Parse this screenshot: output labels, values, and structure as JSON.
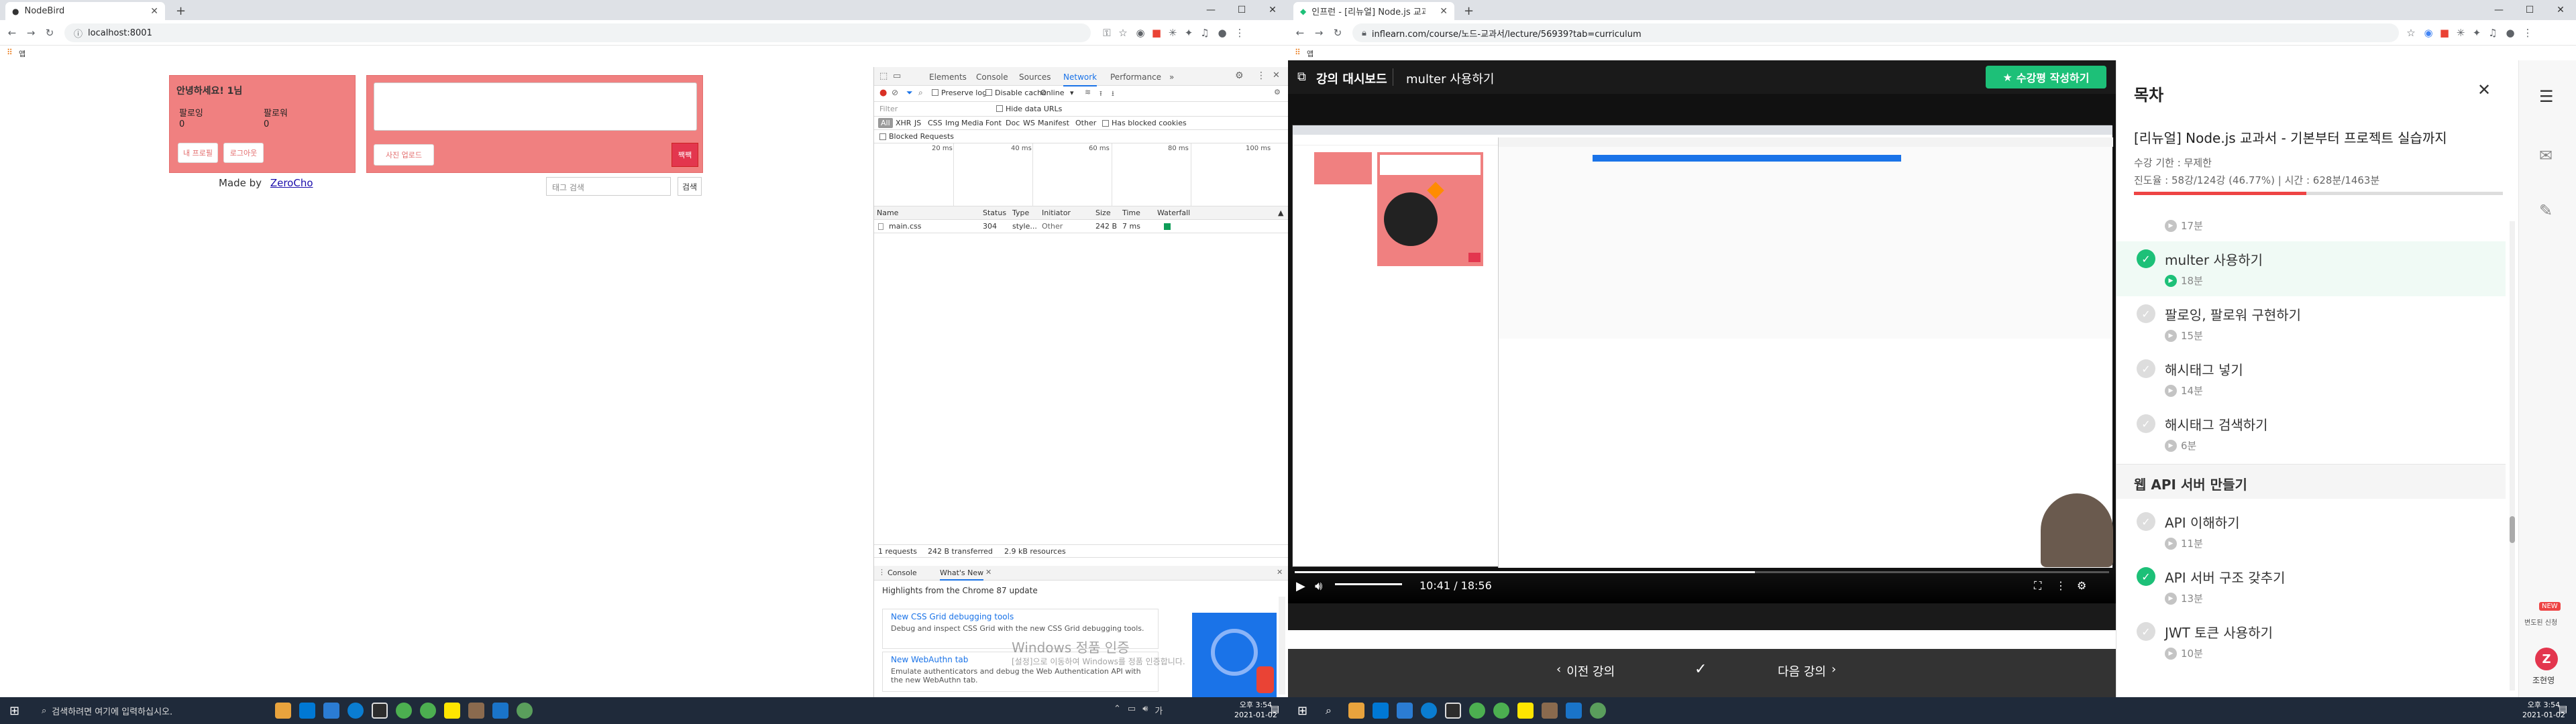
{
  "left": {
    "tabs": [
      {
        "title": "NodeBird"
      }
    ],
    "url": "localhost:8001",
    "bookmark_label": "앱",
    "page": {
      "greeting": "안녕하세요! 1님",
      "following_label": "팔로잉",
      "follower_label": "팔로워",
      "following_count": "0",
      "follower_count": "0",
      "my_profile_btn": "내 프로필",
      "logout_btn": "로그아웃",
      "made_by": "Made by",
      "author_link": "ZeroCho",
      "photo_upload_btn": "사진 업로드",
      "tweet_btn": "짹짹",
      "tag_search_placeholder": "태그 검색",
      "search_btn": "검색"
    },
    "devtools": {
      "tabs": [
        "Elements",
        "Console",
        "Sources",
        "Network",
        "Performance"
      ],
      "active_tab": "Network",
      "preserve_log": "Preserve log",
      "disable_cache": "Disable cache",
      "throttle": "Online",
      "filter_placeholder": "Filter",
      "hide_data_urls": "Hide data URLs",
      "filter_types": [
        "All",
        "XHR",
        "JS",
        "CSS",
        "Img",
        "Media",
        "Font",
        "Doc",
        "WS",
        "Manifest",
        "Other"
      ],
      "has_blocked_cookies": "Has blocked cookies",
      "blocked_requests": "Blocked Requests",
      "timeline_ticks": [
        "20 ms",
        "40 ms",
        "60 ms",
        "80 ms",
        "100 ms"
      ],
      "columns": [
        "Name",
        "Status",
        "Type",
        "Initiator",
        "Size",
        "Time",
        "Waterfall"
      ],
      "rows": [
        {
          "name": "main.css",
          "status": "304",
          "type": "style...",
          "initiator": "Other",
          "size": "242 B",
          "time": "7 ms"
        }
      ],
      "summary": [
        "1 requests",
        "242 B transferred",
        "2.9 kB resources"
      ],
      "drawer_tabs": [
        "Console",
        "What's New"
      ],
      "drawer_heading": "Highlights from the Chrome 87 update",
      "news": [
        {
          "title": "New CSS Grid debugging tools",
          "desc": "Debug and inspect CSS Grid with the new CSS Grid debugging tools."
        },
        {
          "title": "New WebAuthn tab",
          "desc": "Emulate authenticators and debug the Web Authentication API with the new WebAuthn tab."
        }
      ],
      "watermark_title": "Windows 정품 인증",
      "watermark_sub": "[설정]으로 이동하여 Windows를 정품 인증합니다."
    }
  },
  "right": {
    "tabs": [
      {
        "title": "인프런 - [리뉴얼] Node.js 교과서 ..."
      }
    ],
    "url": "inflearn.com/course/노드-교과서/lecture/56939?tab=curriculum",
    "bookmark_label": "앱",
    "dashboard_label": "강의 대시보드",
    "lecture_title": "multer 사용하기",
    "review_btn": "수강평 작성하기",
    "video_time": "10:41 / 18:56",
    "video_progress": 0.565,
    "prev_btn": "이전 강의",
    "next_btn": "다음 강의",
    "sidebar": {
      "title": "목차",
      "course_title": "[리뉴얼] Node.js 교과서 - 기본부터 프로젝트 실습까지",
      "period": "수강 기한 : 무제한",
      "progress_text": "진도율 : 58강/124강 (46.77%) | 시간 : 628분/1463분",
      "progress": 0.4677,
      "lessons": [
        {
          "title": "",
          "duration": "17분",
          "done": false,
          "current": false
        },
        {
          "title": "multer 사용하기",
          "duration": "18분",
          "done": true,
          "current": true
        },
        {
          "title": "팔로잉, 팔로워 구현하기",
          "duration": "15분",
          "done": false,
          "current": false
        },
        {
          "title": "해시태그 넣기",
          "duration": "14분",
          "done": false,
          "current": false
        },
        {
          "title": "해시태그 검색하기",
          "duration": "6분",
          "done": false,
          "current": false
        }
      ],
      "section_title": "웹 API 서버 만들기",
      "section_lessons": [
        {
          "title": "API 이해하기",
          "duration": "11분",
          "done": false
        },
        {
          "title": "API 서버 구조 갖추기",
          "duration": "13분",
          "done": true
        },
        {
          "title": "JWT 토큰 사용하기",
          "duration": "10분",
          "done": false
        }
      ]
    },
    "rail": {
      "new_badge": "NEW",
      "new_label": "변도된 신청",
      "user_name": "조현영"
    }
  },
  "taskbar": {
    "search_placeholder": "검색하려면 여기에 입력하십시오.",
    "time": "오후 3:54",
    "date": "2021-01-02"
  },
  "colors": {
    "pink": "#f08080",
    "inflearn_green": "#1dc078",
    "dark": "#1a1a1a",
    "taskbar": "#1f2a3a"
  }
}
